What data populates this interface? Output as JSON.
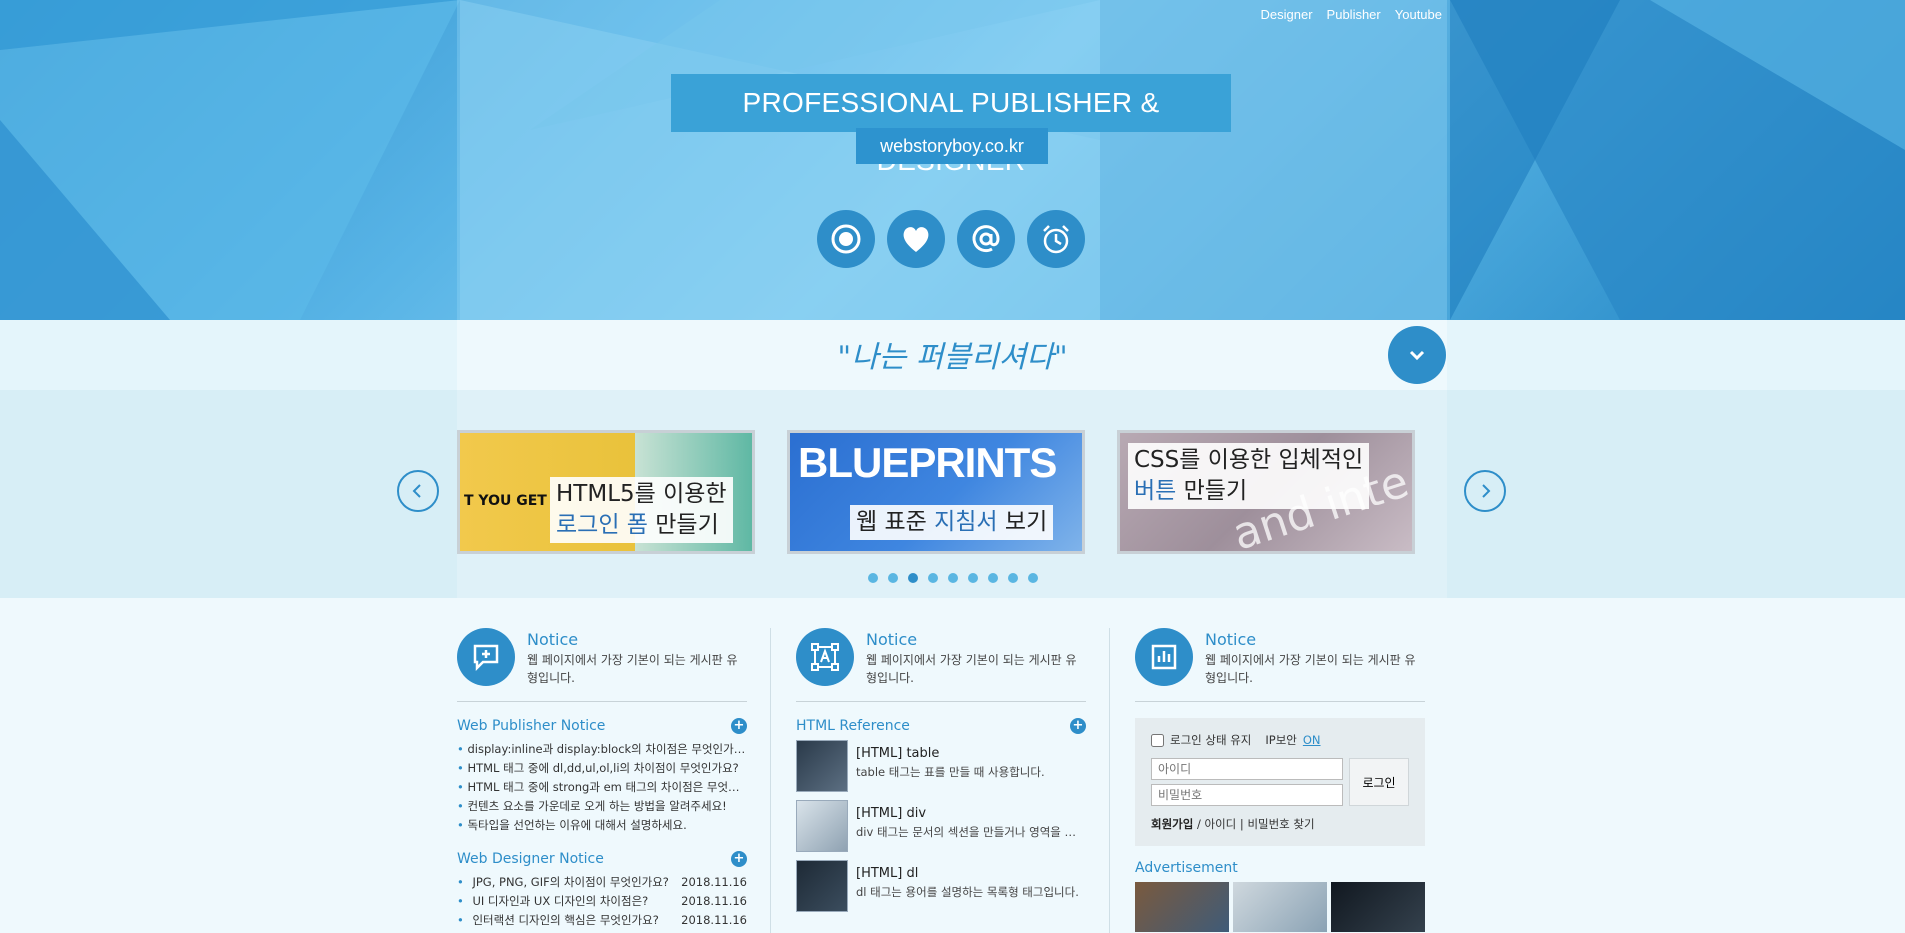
{
  "nav": {
    "items": [
      "Designer",
      "Publisher",
      "Youtube"
    ]
  },
  "hero": {
    "title": "PROFESSIONAL PUBLISHER & DESIGNER",
    "subtitle": "webstoryboy.co.kr",
    "icons": [
      "target-icon",
      "heart-icon",
      "at-icon",
      "alarm-icon"
    ]
  },
  "quote": {
    "text": "\"나는 퍼블리셔다\""
  },
  "slider": {
    "slides": [
      {
        "line1": "HTML5를 이용한",
        "line2_blue": "로그인 폼",
        "line2_rest": " 만들기",
        "bg_label": "T YOU GET"
      },
      {
        "line1_rest": "웹 표준 ",
        "line1_blue": "지침서",
        "line1_after": " 보기",
        "bg_label": "BLUEPRINTS"
      },
      {
        "line1": "CSS를 이용한 입체적인",
        "line2_blue": "버튼",
        "line2_rest": " 만들기",
        "bg_label": "and inte"
      }
    ],
    "dot_count": 9,
    "active_dot": 2
  },
  "columns": {
    "col1": {
      "title": "Notice",
      "desc": "웹 페이지에서 가장 기본이 되는 게시판 유형입니다.",
      "publisher": {
        "title": "Web Publisher Notice",
        "items": [
          "display:inline과 display:block의 차이점은 무엇인가요?",
          "HTML 태그 중에 dl,dd,ul,ol,li의 차이점이 무엇인가요?",
          "HTML 태그 중에 strong과 em 태그의 차이점은 무엇인가요?",
          "컨텐츠 요소를 가운데로 오게 하는 방법을 알려주세요!",
          "독타입을 선언하는 이유에 대해서 설명하세요."
        ]
      },
      "designer": {
        "title": "Web Designer Notice",
        "items": [
          {
            "text": "JPG, PNG, GIF의 차이점이 무엇인가요?",
            "date": "2018.11.16"
          },
          {
            "text": "UI 디자인과 UX 디자인의 차이점은?",
            "date": "2018.11.16"
          },
          {
            "text": "인터랙션 디자인의 핵심은 무엇인가요?",
            "date": "2018.11.16"
          }
        ]
      }
    },
    "col2": {
      "title": "Notice",
      "desc": "웹 페이지에서 가장 기본이 되는 게시판 유형입니다.",
      "reference": {
        "title": "HTML Reference",
        "items": [
          {
            "title": "[HTML] table",
            "desc": "table 태그는 표를 만들 때 사용합니다."
          },
          {
            "title": "[HTML] div",
            "desc": "div 태그는 문서의 섹션을 만들거나 영역을 나눌 때 사용합니다."
          },
          {
            "title": "[HTML] dl",
            "desc": "dl 태그는 용어를 설명하는 목록형 태그입니다."
          }
        ]
      }
    },
    "col3": {
      "title": "Notice",
      "desc": "웹 페이지에서 가장 기본이 되는 게시판 유형입니다.",
      "login": {
        "keep_label": "로그인 상태 유지",
        "ip_label": "IP보안",
        "ip_state": "ON",
        "id_placeholder": "아이디",
        "pw_placeholder": "비밀번호",
        "button": "로그인",
        "signup": "회원가입",
        "find": " / 아이디 | 비밀번호 찾기"
      },
      "ad_title": "Advertisement"
    }
  },
  "colors": {
    "accent": "#2e8ec9",
    "header": "#58b4e6"
  }
}
